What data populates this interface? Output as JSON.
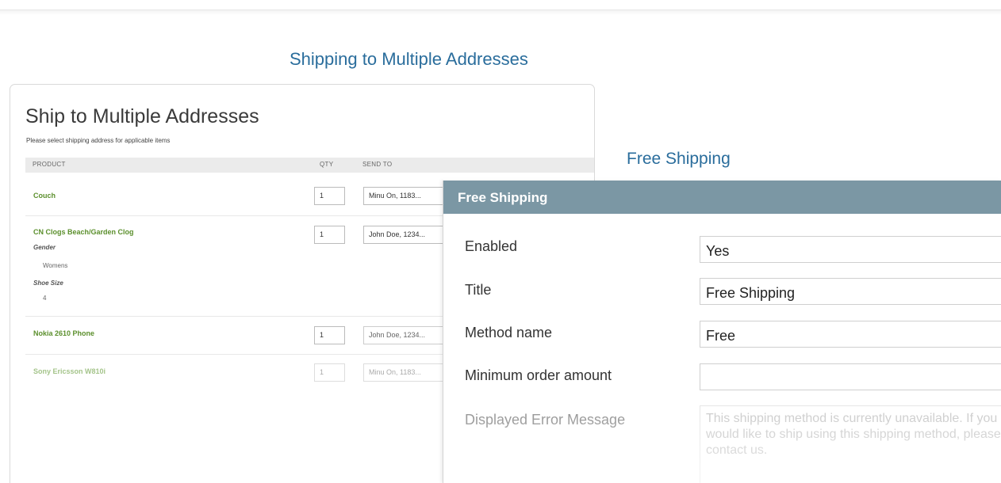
{
  "headings": {
    "left": "Shipping to Multiple Addresses",
    "right": "Free Shipping"
  },
  "multi_address": {
    "title": "Ship to Multiple Addresses",
    "subtitle": "Please select shipping address for applicable items",
    "columns": [
      "PRODUCT",
      "QTY",
      "SEND TO"
    ],
    "rows": [
      {
        "product": "Couch",
        "qty": "1",
        "send_to": "Minu On, 1183..."
      },
      {
        "product": "CN Clogs Beach/Garden Clog",
        "qty": "1",
        "send_to": "John Doe, 1234...",
        "options": [
          {
            "label": "Gender",
            "value": "Womens"
          },
          {
            "label": "Shoe Size",
            "value": "4"
          }
        ]
      },
      {
        "product": "Nokia 2610 Phone",
        "qty": "1",
        "send_to": "John Doe, 1234..."
      },
      {
        "product": "Sony Ericsson W810i",
        "qty": "1",
        "send_to": "Minu On, 1183..."
      }
    ]
  },
  "free_shipping_config": {
    "header": "Free Shipping",
    "fields": [
      {
        "label": "Enabled",
        "value": "Yes"
      },
      {
        "label": "Title",
        "value": "Free Shipping"
      },
      {
        "label": "Method name",
        "value": "Free"
      },
      {
        "label": "Minimum order amount",
        "value": ""
      },
      {
        "label": "Displayed Error Message",
        "value": "This shipping method is currently unavailable. If you would like to ship using this shipping method, please contact us."
      }
    ]
  },
  "colors": {
    "heading_blue": "#2a6d9c",
    "product_green": "#5b8f2c",
    "config_header": "#7b97a4"
  }
}
